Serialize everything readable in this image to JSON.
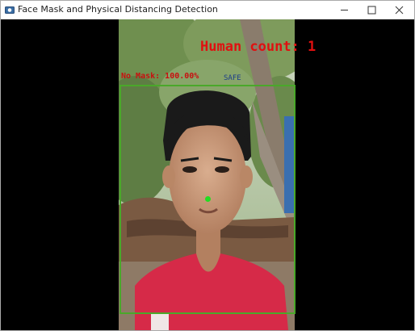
{
  "window": {
    "title": "Face Mask and Physical Distancing Detection",
    "icon": "camera-app-icon",
    "controls": {
      "minimize": "minimize-icon",
      "maximize": "maximize-icon",
      "close": "close-icon"
    }
  },
  "overlay": {
    "human_count_text": "Human count: 1",
    "mask_label_text": "No Mask: 100.00%",
    "status_text": "SAFE",
    "count_color": "#e01010",
    "label_color": "#c81010",
    "status_color": "#1c3c8a",
    "box_color": "#4aa82a",
    "centroid_color": "#22dd22"
  }
}
